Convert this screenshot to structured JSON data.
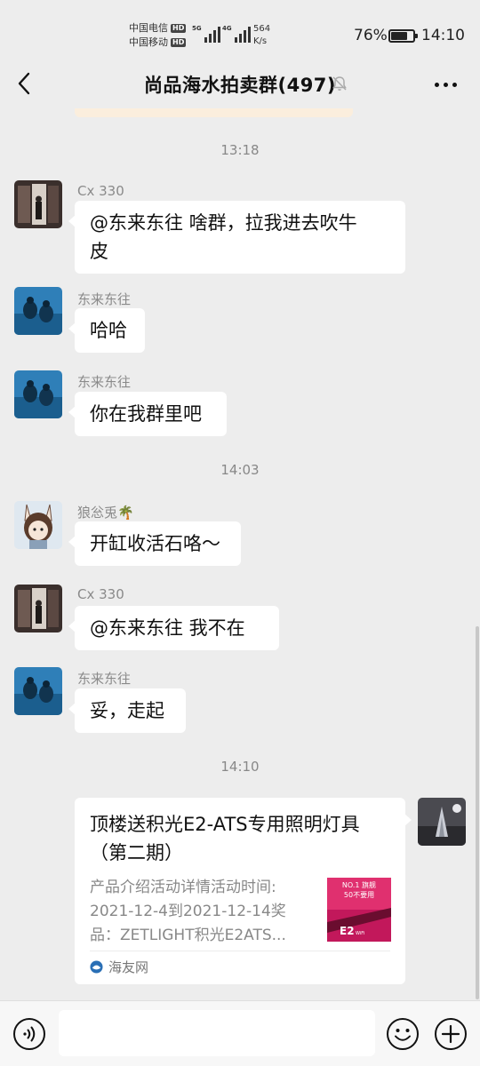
{
  "status_bar": {
    "carrier1": "中国电信",
    "carrier2": "中国移动",
    "hd": "HD",
    "net1": "5G",
    "net2": "4G",
    "speed_value": "564",
    "speed_unit": "K/s",
    "battery_pct": "76%",
    "battery_level": 0.76,
    "time": "14:10"
  },
  "nav": {
    "back_icon": "chevron-left-icon",
    "title": "尚品海水拍卖群(497)",
    "mute_icon": "bell-muted-icon",
    "more_icon": "more-dots-icon"
  },
  "chat": {
    "time1": "13:18",
    "time2": "14:03",
    "time3": "14:10",
    "messages": [
      {
        "sender": "Cx 330",
        "text_line1": "@东来东往  啥群，拉我进去吹牛",
        "text_line2": "皮"
      },
      {
        "sender": "东来东往",
        "text": "哈哈"
      },
      {
        "sender": "东来东往",
        "text": "你在我群里吧"
      },
      {
        "sender": "狼忩兎🌴",
        "text": "开缸收活石咯～"
      },
      {
        "sender": "Cx 330",
        "text": "@东来东往  我不在"
      },
      {
        "sender": "东来东往",
        "text": "妥，走起"
      }
    ],
    "link_card": {
      "title_line1": "顶楼送积光E2-ATS专用照明灯具",
      "title_line2": "（第二期）",
      "desc_line1": "产品介绍活动详情活动时间:",
      "desc_line2": "2021-12-4到2021-12-14奖",
      "desc_line3": "品：ZETLIGHT积光E2ATS...",
      "thumb_line1": "NO.1 旗舰",
      "thumb_line2": "50不要用",
      "thumb_brand": "E2",
      "thumb_sub": "WiFi",
      "source": "海友网"
    }
  },
  "input_bar": {
    "voice_icon": "voice-icon",
    "placeholder": "",
    "emoji_icon": "emoji-icon",
    "plus_icon": "plus-icon"
  }
}
